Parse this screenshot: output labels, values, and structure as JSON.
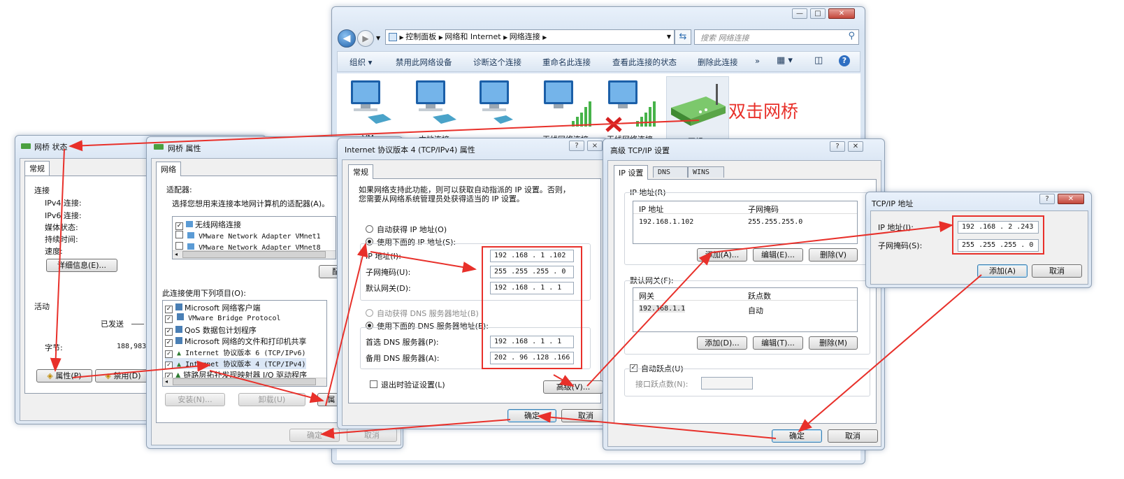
{
  "annotation": {
    "text": "双击网桥",
    "color": "#e8302a"
  },
  "explorer": {
    "breadcrumb": [
      "控制面板",
      "网络和 Internet",
      "网络连接"
    ],
    "search_placeholder": "搜索 网络连接",
    "toolbar": [
      "组织",
      "禁用此网络设备",
      "诊断这个连接",
      "重命名此连接",
      "查看此连接的状态",
      "删除此连接"
    ],
    "more": "»",
    "adapters": [
      "VM",
      "本地连接",
      "无线网络连接",
      "无线网络连接",
      "网桥"
    ]
  },
  "status_win": {
    "title": "网桥 状态",
    "tab": "常规",
    "conn_label": "连接",
    "ipv4": "IPv4 连接:",
    "ipv6": "IPv6 连接:",
    "media": "媒体状态:",
    "duration": "持续时间:",
    "speed": "速度:",
    "details_btn": "详细信息(E)...",
    "activity": "活动",
    "sent": "已发送",
    "bytes_label": "字节:",
    "bytes_value": "188,983",
    "props_btn": "属性(P)",
    "disable_btn": "禁用(D)"
  },
  "props_win": {
    "title": "网桥 属性",
    "tab": "网络",
    "adapter_group": "适配器:",
    "adapter_hint": "选择您想用来连接本地网计算机的适配器(A)。",
    "adapters": [
      {
        "name": "无线网络连接",
        "checked": true
      },
      {
        "name": "VMware Network Adapter VMnet1",
        "checked": false
      },
      {
        "name": "VMware Network Adapter VMnet8",
        "checked": false
      }
    ],
    "config_btn": "配置",
    "items_label": "此连接使用下列项目(O):",
    "items": [
      "Microsoft 网络客户端",
      "VMware Bridge Protocol",
      "QoS 数据包计划程序",
      "Microsoft 网络的文件和打印机共享",
      "Internet 协议版本 6 (TCP/IPv6)",
      "Internet 协议版本 4 (TCP/IPv4)",
      "链路层拓扑发现映射器 I/O 驱动程序"
    ],
    "install_btn": "安装(N)...",
    "uninstall_btn": "卸载(U)",
    "props_btn": "属",
    "ok": "确定",
    "cancel": "取消"
  },
  "ipv4_win": {
    "title": "Internet 协议版本 4 (TCP/IPv4) 属性",
    "help": "?",
    "close": "×",
    "tab": "常规",
    "intro1": "如果网络支持此功能，则可以获取自动指派的 IP 设置。否则，",
    "intro2": "您需要从网络系统管理员处获得适当的 IP 设置。",
    "auto_ip": "自动获得 IP 地址(O)",
    "manual_ip": "使用下面的 IP 地址(S):",
    "ip_label": "IP 地址(I):",
    "ip": "192 .168 . 1 .102",
    "mask_label": "子网掩码(U):",
    "mask": "255 .255 .255 . 0",
    "gw_label": "默认网关(D):",
    "gw": "192 .168 . 1 . 1",
    "auto_dns": "自动获得 DNS 服务器地址(B)",
    "manual_dns": "使用下面的 DNS 服务器地址(E):",
    "dns1_label": "首选 DNS 服务器(P):",
    "dns1": "192 .168 . 1 . 1",
    "dns2_label": "备用 DNS 服务器(A):",
    "dns2": "202 . 96 .128 .166",
    "validate": "退出时验证设置(L)",
    "advanced": "高级(V)...",
    "ok": "确定",
    "cancel": "取消"
  },
  "adv_win": {
    "title": "高级 TCP/IP 设置",
    "tabs": [
      "IP 设置",
      "DNS",
      "WINS"
    ],
    "ip_group": "IP 地址(R)",
    "ip_col": "IP 地址",
    "mask_col": "子网掩码",
    "ip_row": "192.168.1.102",
    "mask_row": "255.255.255.0",
    "add": "添加(A)...",
    "edit": "编辑(E)...",
    "remove": "删除(V)",
    "gw_group": "默认网关(F):",
    "gw_col": "网关",
    "metric_col": "跃点数",
    "gw_row": "192.168.1.1",
    "metric_row": "自动",
    "add2": "添加(D)...",
    "edit2": "编辑(T)...",
    "remove2": "删除(M)",
    "auto_metric": "自动跃点(U)",
    "iface_metric": "接口跃点数(N):",
    "ok": "确定",
    "cancel": "取消"
  },
  "tcpip_win": {
    "title": "TCP/IP 地址",
    "ip_label": "IP 地址(I):",
    "ip": "192 .168 . 2 .243",
    "mask_label": "子网掩码(S):",
    "mask": "255 .255 .255 . 0",
    "add": "添加(A)",
    "cancel": "取消"
  }
}
